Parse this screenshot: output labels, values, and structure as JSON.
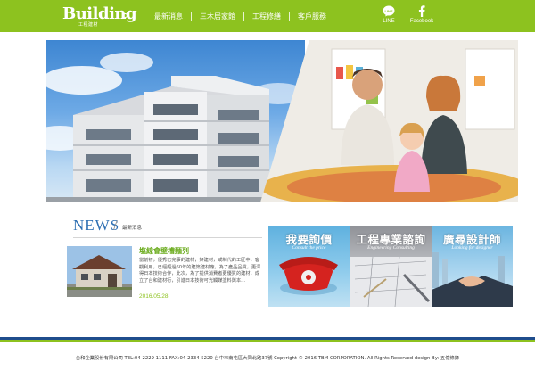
{
  "header": {
    "logo_text": "Building",
    "logo_sub": "工程建材",
    "nav": [
      {
        "label": "最新消息"
      },
      {
        "label": "三木居家館"
      },
      {
        "label": "工程修繕"
      },
      {
        "label": "客戶服務"
      }
    ],
    "social": {
      "line_label": "LINE",
      "facebook_label": "Facebook"
    }
  },
  "news": {
    "title": "NEWS",
    "subtitle": "最新消息",
    "item": {
      "headline": "塩線會壁槽麵列",
      "body": "當前初，優秀已完事的建材，好建材，或制代的工匠中，客觀利用，已經超過60年的建築建材廠，為了產品品質，更深得日本技術合作，此次，為了提供消費者更優質的建材，成立了台和建材行，引進日本技術可光觸媒塗料與本...",
      "date": "2016.05.28"
    }
  },
  "cards": [
    {
      "title": "我要詢價",
      "subtitle": "Consult the price"
    },
    {
      "title": "工程專業諮詢",
      "subtitle": "Engineering Consulting"
    },
    {
      "title": "廣尋設計師",
      "subtitle": "Looking for designer"
    }
  ],
  "footer": {
    "text": "台和企業股份有限公司 TEL:04-2229 1111 FAX:04-2334 5220 台中市南屯區大同北路37號    Copyright © 2016 TBM CORPORATION. All Rights Reserved design By: 五億條錄"
  },
  "colors": {
    "brand_green": "#8dc21f",
    "news_blue": "#2d6fb3",
    "footer_navy": "#1f4d8c"
  }
}
